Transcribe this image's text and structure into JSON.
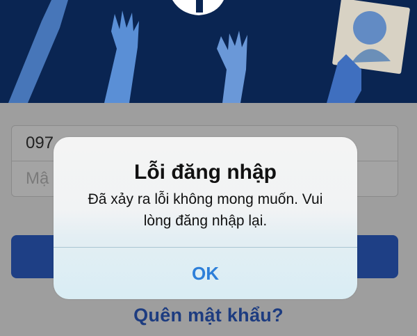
{
  "login_form": {
    "phone_value": "097",
    "password_placeholder": "Mậ",
    "forgot_password": "Quên mật khẩu?"
  },
  "alert": {
    "title": "Lỗi đăng nhập",
    "message": "Đã xảy ra lỗi không mong muốn. Vui lòng đăng nhập lại.",
    "ok_label": "OK"
  },
  "colors": {
    "header_bg": "#0a2552",
    "alert_button": "#2d7fd9",
    "forgot_link": "#1d3c80"
  },
  "icons": [
    "facebook-logo-icon",
    "profile-picture-frame-icon"
  ]
}
